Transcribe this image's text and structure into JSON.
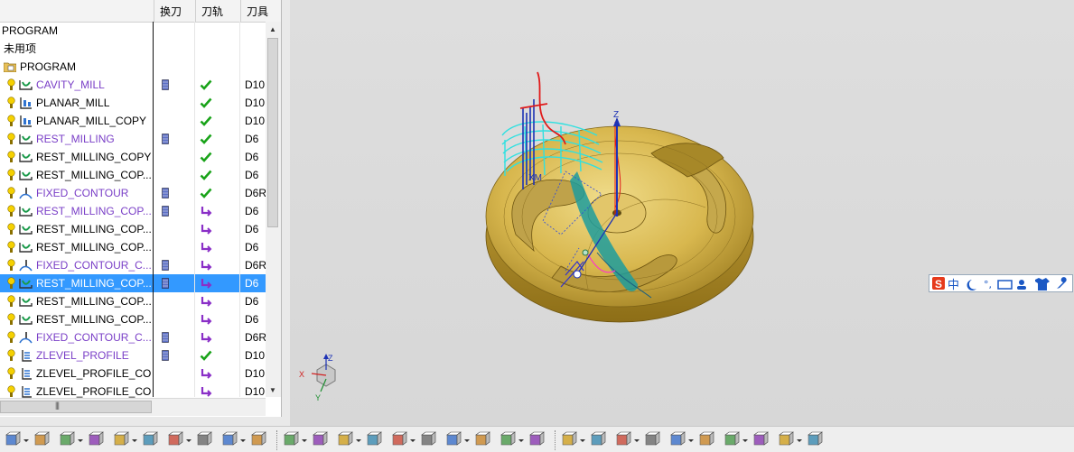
{
  "navigator": {
    "columns": {
      "name": "",
      "tool_change": "换刀",
      "toolpath": "刀轨",
      "tool": "刀具"
    },
    "rows": [
      {
        "kind": "root",
        "name": "PROGRAM",
        "tool_change": false,
        "status": "none",
        "tool": "",
        "style": "black"
      },
      {
        "kind": "group",
        "name": "未用项",
        "tool_change": false,
        "status": "none",
        "tool": "",
        "style": "black"
      },
      {
        "kind": "program",
        "name": "PROGRAM",
        "tool_change": false,
        "status": "none",
        "tool": "",
        "style": "black"
      },
      {
        "kind": "op",
        "icon": "cavity-mill-icon",
        "name": "CAVITY_MILL",
        "tool_change": true,
        "status": "check",
        "tool": "D10",
        "style": "purple"
      },
      {
        "kind": "op",
        "icon": "planar-mill-icon",
        "name": "PLANAR_MILL",
        "tool_change": false,
        "status": "check",
        "tool": "D10",
        "style": "black"
      },
      {
        "kind": "op",
        "icon": "planar-mill-icon",
        "name": "PLANAR_MILL_COPY",
        "tool_change": false,
        "status": "check",
        "tool": "D10",
        "style": "black"
      },
      {
        "kind": "op",
        "icon": "cavity-mill-icon",
        "name": "REST_MILLING",
        "tool_change": true,
        "status": "check",
        "tool": "D6",
        "style": "purple"
      },
      {
        "kind": "op",
        "icon": "cavity-mill-icon",
        "name": "REST_MILLING_COPY",
        "tool_change": false,
        "status": "check",
        "tool": "D6",
        "style": "black"
      },
      {
        "kind": "op",
        "icon": "cavity-mill-icon",
        "name": "REST_MILLING_COP...",
        "tool_change": false,
        "status": "check",
        "tool": "D6",
        "style": "black"
      },
      {
        "kind": "op",
        "icon": "fixed-contour-icon",
        "name": "FIXED_CONTOUR",
        "tool_change": true,
        "status": "check",
        "tool": "D6R",
        "style": "purple"
      },
      {
        "kind": "op",
        "icon": "cavity-mill-icon",
        "name": "REST_MILLING_COP...",
        "tool_change": true,
        "status": "regen",
        "tool": "D6",
        "style": "purple"
      },
      {
        "kind": "op",
        "icon": "cavity-mill-icon",
        "name": "REST_MILLING_COP...",
        "tool_change": false,
        "status": "regen",
        "tool": "D6",
        "style": "black"
      },
      {
        "kind": "op",
        "icon": "cavity-mill-icon",
        "name": "REST_MILLING_COP...",
        "tool_change": false,
        "status": "regen",
        "tool": "D6",
        "style": "black"
      },
      {
        "kind": "op",
        "icon": "fixed-contour-icon",
        "name": "FIXED_CONTOUR_C...",
        "tool_change": true,
        "status": "regen",
        "tool": "D6R",
        "style": "purple"
      },
      {
        "kind": "op",
        "icon": "cavity-mill-icon",
        "name": "REST_MILLING_COP...",
        "tool_change": true,
        "status": "regen",
        "tool": "D6",
        "style": "purple",
        "selected": true
      },
      {
        "kind": "op",
        "icon": "cavity-mill-icon",
        "name": "REST_MILLING_COP...",
        "tool_change": false,
        "status": "regen",
        "tool": "D6",
        "style": "black"
      },
      {
        "kind": "op",
        "icon": "cavity-mill-icon",
        "name": "REST_MILLING_COP...",
        "tool_change": false,
        "status": "regen",
        "tool": "D6",
        "style": "black"
      },
      {
        "kind": "op",
        "icon": "fixed-contour-icon",
        "name": "FIXED_CONTOUR_C...",
        "tool_change": true,
        "status": "regen",
        "tool": "D6R",
        "style": "purple"
      },
      {
        "kind": "op",
        "icon": "zlevel-icon",
        "name": "ZLEVEL_PROFILE",
        "tool_change": true,
        "status": "check",
        "tool": "D10",
        "style": "purple"
      },
      {
        "kind": "op",
        "icon": "zlevel-icon",
        "name": "ZLEVEL_PROFILE_CO...",
        "tool_change": false,
        "status": "regen",
        "tool": "D10",
        "style": "black"
      },
      {
        "kind": "op",
        "icon": "zlevel-icon",
        "name": "ZLEVEL_PROFILE_CO...",
        "tool_change": false,
        "status": "regen",
        "tool": "D10",
        "style": "black"
      }
    ]
  },
  "viewport": {
    "axis_labels": {
      "z": "Z",
      "xm": "XM",
      "x": "X",
      "y": "Y"
    }
  },
  "ime": {
    "label": "中",
    "icons": [
      "sogou-s-icon",
      "chinese-mode-label",
      "moon-icon",
      "punctuation-icon",
      "keyboard-icon",
      "user-icon",
      "shirt-icon",
      "wrench-icon"
    ]
  },
  "toolbar": {
    "icons": [
      "view-icon",
      "layout-icon",
      "tool-icon",
      "tool-holder-icon",
      "geometry-icon",
      "method-icon",
      "blank-icon",
      "part-icon",
      "operation-icon",
      "text-icon",
      "more-icon",
      "verify-icon",
      "machine-icon",
      "simulate-icon",
      "postprocess-icon",
      "shop-doc-icon",
      "mirror-icon",
      "transform-icon",
      "assembly-icon",
      "route-icon",
      "box-icon",
      "link-icon",
      "path-icon",
      "tree-icon",
      "cube-icon",
      "paint-icon",
      "chain-icon",
      "cross-icon",
      "layer-icon",
      "stack-icon"
    ]
  }
}
